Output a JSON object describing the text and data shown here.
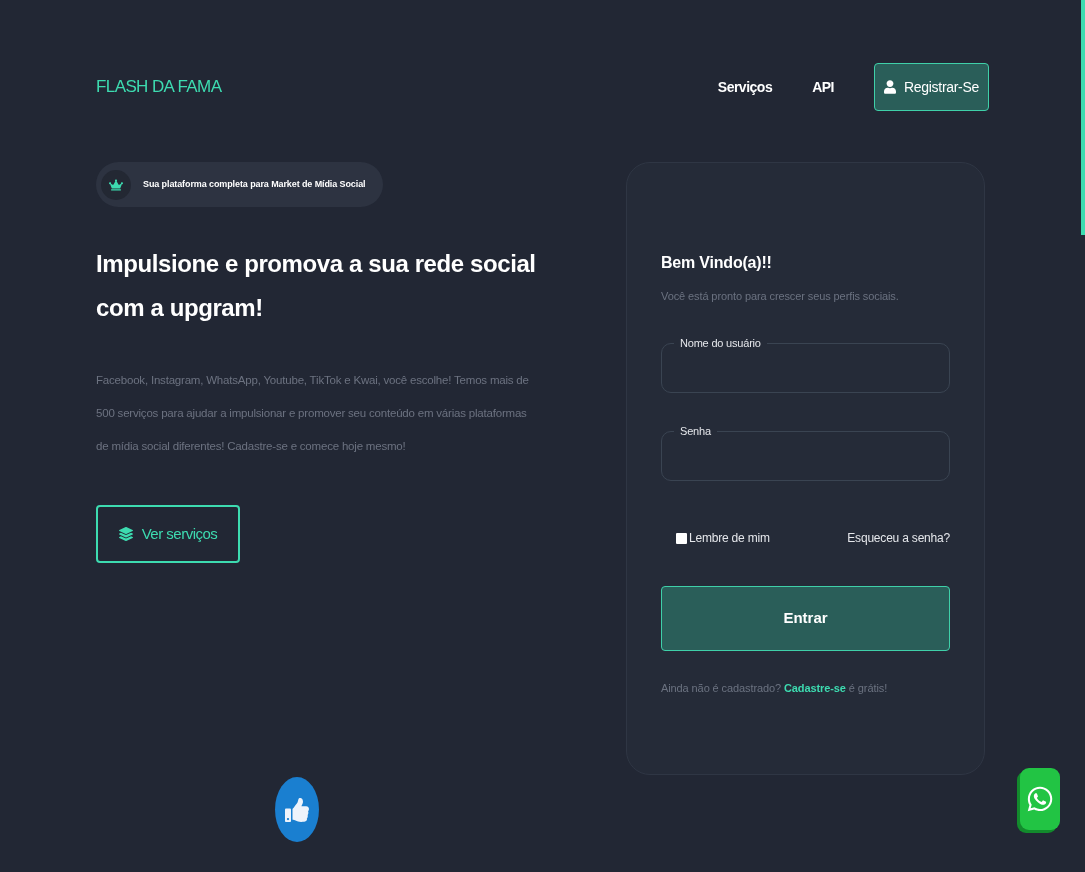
{
  "nav": {
    "logo": "FLASH DA FAMA",
    "links": [
      "Serviços",
      "API"
    ],
    "register_button": "Registrar-Se"
  },
  "hero": {
    "badge": "Sua plataforma completa para Market de Mídia Social",
    "heading": "Impulsione e promova a sua rede social com a upgram!",
    "description": "Facebook, Instagram, WhatsApp, Youtube, TikTok e Kwai, você escolhe! Temos mais de 500 serviços para ajudar a impulsionar e promover seu conteúdo em várias plataformas de mídia social diferentes! Cadastre-se e comece hoje mesmo!",
    "button": "Ver serviços"
  },
  "login": {
    "title": "Bem Vindo(a)!!",
    "subtitle": "Você está pronto para crescer seus perfis sociais.",
    "fields": [
      {
        "label": "Nome do usuário"
      },
      {
        "label": "Senha"
      }
    ],
    "remember": {
      "label": "Lembre de mim",
      "checked": false
    },
    "forgot": "Esqueceu a senha?",
    "submit": "Entrar",
    "signup": {
      "text": "Ainda não é cadastrado?",
      "link": "Cadastre-se",
      "suffix": "é grátis!"
    }
  }
}
